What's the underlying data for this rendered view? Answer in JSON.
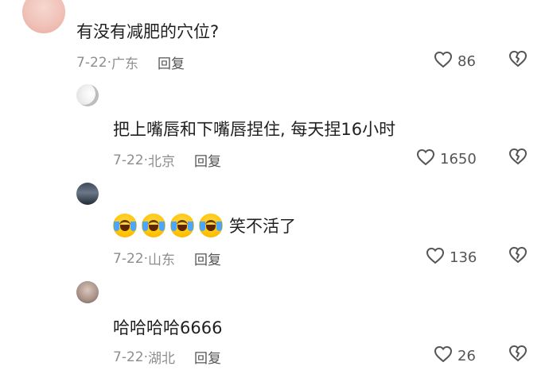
{
  "comments": [
    {
      "text": "有没有减肥的穴位?",
      "date": "7-22",
      "location": "广东",
      "reply_label": "回复",
      "likes": "86",
      "avatar_icon": "girl-avatar-icon"
    },
    {
      "text": "把上嘴唇和下嘴唇捏住, 每天捏16小时",
      "date": "7-22",
      "location": "北京",
      "reply_label": "回复",
      "likes": "1650",
      "avatar_icon": "moon-avatar-icon"
    },
    {
      "text": "笑不活了",
      "date": "7-22",
      "location": "山东",
      "reply_label": "回复",
      "likes": "136",
      "avatar_icon": "city-avatar-icon",
      "emoji_name": "laughing-crying-emoji",
      "emoji_count": 4
    },
    {
      "text": "哈哈哈哈6666",
      "date": "7-22",
      "location": "湖北",
      "reply_label": "回复",
      "likes": "26",
      "avatar_icon": "girl-avatar-icon"
    }
  ],
  "colors": {
    "text": "#1f1f1f",
    "meta": "#8e8e8e",
    "reply": "#555555",
    "icon": "#555555",
    "background": "#ffffff"
  },
  "icons": {
    "like": "heart-outline-icon",
    "dislike": "broken-heart-icon"
  }
}
